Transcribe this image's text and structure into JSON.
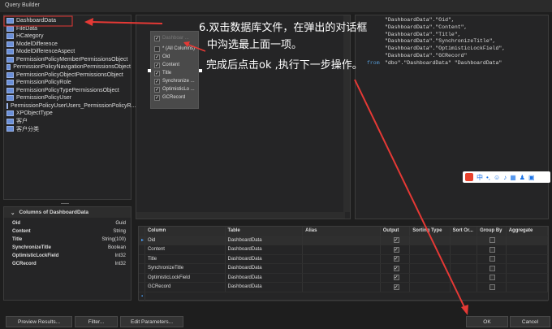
{
  "window": {
    "title": "Query Builder"
  },
  "tables": [
    "DashboardData",
    "FileData",
    "HCategory",
    "ModelDifference",
    "ModelDifferenceAspect",
    "PermissionPolicyMemberPermissionsObject",
    "PermissionPolicyNavigationPermissionsObject",
    "PermissionPolicyObjectPermissionsObject",
    "PermissionPolicyRole",
    "PermissionPolicyTypePermissionsObject",
    "PermissionPolicyUser",
    "PermissionPolicyUserUsers_PermissionPolicyR...",
    "XPObjectType",
    "客户",
    "客户分类"
  ],
  "columns_panel": {
    "title": "Columns of DashboardData",
    "rows": [
      {
        "name": "Oid",
        "type": "Guid"
      },
      {
        "name": "Content",
        "type": "String"
      },
      {
        "name": "Title",
        "type": "String(100)"
      },
      {
        "name": "SynchronizeTitle",
        "type": "Boolean"
      },
      {
        "name": "OptimisticLockField",
        "type": "Int32"
      },
      {
        "name": "GCRecord",
        "type": "Int32"
      }
    ]
  },
  "node": {
    "title": "Dashboar ...",
    "items": [
      {
        "label": "* (All Columns)",
        "checked": false
      },
      {
        "label": "Oid",
        "checked": true
      },
      {
        "label": "Content",
        "checked": true
      },
      {
        "label": "Title",
        "checked": true
      },
      {
        "label": "Synchronize ...",
        "checked": true
      },
      {
        "label": "OptimisticLo ...",
        "checked": true
      },
      {
        "label": "GCRecord",
        "checked": true
      }
    ]
  },
  "annotation": {
    "line1": "6.双击数据库文件，在弹出的对话框",
    "line2": "中沟选最上面一项。",
    "line3": "完成后点击ok ,执行下一步操作。"
  },
  "sql": {
    "lines": [
      "\"DashboardData\".\"Oid\",",
      "\"DashboardData\".\"Content\",",
      "\"DashboardData\".\"Title\",",
      "\"DashboardData\".\"SynchronizeTitle\",",
      "\"DashboardData\".\"OptimisticLockField\",",
      "\"DashboardData\".\"GCRecord\"",
      "\"dbo\".\"DashboardData\" \"DashboardData\""
    ],
    "from_keyword": "from"
  },
  "grid": {
    "headers": [
      "Column",
      "Table",
      "Alias",
      "Output",
      "Sorting Type",
      "Sort Or...",
      "Group By",
      "Aggregate"
    ],
    "rows": [
      {
        "column": "Oid",
        "table": "DashboardData",
        "output": true,
        "group_by": false
      },
      {
        "column": "Content",
        "table": "DashboardData",
        "output": true,
        "group_by": false
      },
      {
        "column": "Title",
        "table": "DashboardData",
        "output": true,
        "group_by": false
      },
      {
        "column": "SynchronizeTitle",
        "table": "DashboardData",
        "output": true,
        "group_by": false
      },
      {
        "column": "OptimisticLockField",
        "table": "DashboardData",
        "output": true,
        "group_by": false
      },
      {
        "column": "GCRecord",
        "table": "DashboardData",
        "output": true,
        "group_by": false
      }
    ]
  },
  "buttons": {
    "preview": "Preview Results...",
    "filter": "Filter...",
    "edit_params": "Edit Parameters...",
    "ok": "OK",
    "cancel": "Cancel"
  },
  "ime": {
    "label": "中"
  },
  "colors": {
    "annotation_red": "#e53935",
    "table_icon": "#6a8fd8"
  }
}
